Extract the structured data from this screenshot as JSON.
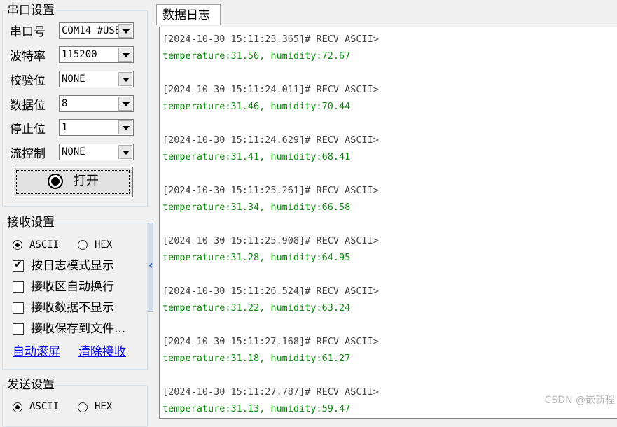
{
  "serial": {
    "title": "串口设置",
    "fields": [
      {
        "label": "串口号",
        "value": "COM14 #USB"
      },
      {
        "label": "波特率",
        "value": "115200"
      },
      {
        "label": "校验位",
        "value": "NONE"
      },
      {
        "label": "数据位",
        "value": "8"
      },
      {
        "label": "停止位",
        "value": "1"
      },
      {
        "label": "流控制",
        "value": "NONE"
      }
    ],
    "open_button": "打开"
  },
  "receive": {
    "title": "接收设置",
    "radios": [
      {
        "label": "ASCII",
        "checked": true
      },
      {
        "label": "HEX",
        "checked": false
      }
    ],
    "checks": [
      {
        "label": "按日志模式显示",
        "checked": true
      },
      {
        "label": "接收区自动换行",
        "checked": false
      },
      {
        "label": "接收数据不显示",
        "checked": false
      },
      {
        "label": "接收保存到文件...",
        "checked": false
      }
    ],
    "links": [
      "自动滚屏",
      "清除接收"
    ]
  },
  "send": {
    "title": "发送设置",
    "radios": [
      {
        "label": "ASCII",
        "checked": true
      },
      {
        "label": "HEX",
        "checked": false
      }
    ]
  },
  "tab": {
    "label": "数据日志"
  },
  "log": [
    {
      "header": "[2024-10-30 15:11:23.365]# RECV ASCII>",
      "data": "temperature:31.56, humidity:72.67"
    },
    {
      "header": "[2024-10-30 15:11:24.011]# RECV ASCII>",
      "data": "temperature:31.46, humidity:70.44"
    },
    {
      "header": "[2024-10-30 15:11:24.629]# RECV ASCII>",
      "data": "temperature:31.41, humidity:68.41"
    },
    {
      "header": "[2024-10-30 15:11:25.261]# RECV ASCII>",
      "data": "temperature:31.34, humidity:66.58"
    },
    {
      "header": "[2024-10-30 15:11:25.908]# RECV ASCII>",
      "data": "temperature:31.28, humidity:64.95"
    },
    {
      "header": "[2024-10-30 15:11:26.524]# RECV ASCII>",
      "data": "temperature:31.22, humidity:63.24"
    },
    {
      "header": "[2024-10-30 15:11:27.168]# RECV ASCII>",
      "data": "temperature:31.18, humidity:61.27"
    },
    {
      "header": "[2024-10-30 15:11:27.787]# RECV ASCII>",
      "data": "temperature:31.13, humidity:59.47"
    }
  ],
  "watermark": "CSDN @嵌新程",
  "colors": {
    "log_header": "#444444",
    "log_data": "#0a8a0a",
    "link": "#0000ee"
  }
}
